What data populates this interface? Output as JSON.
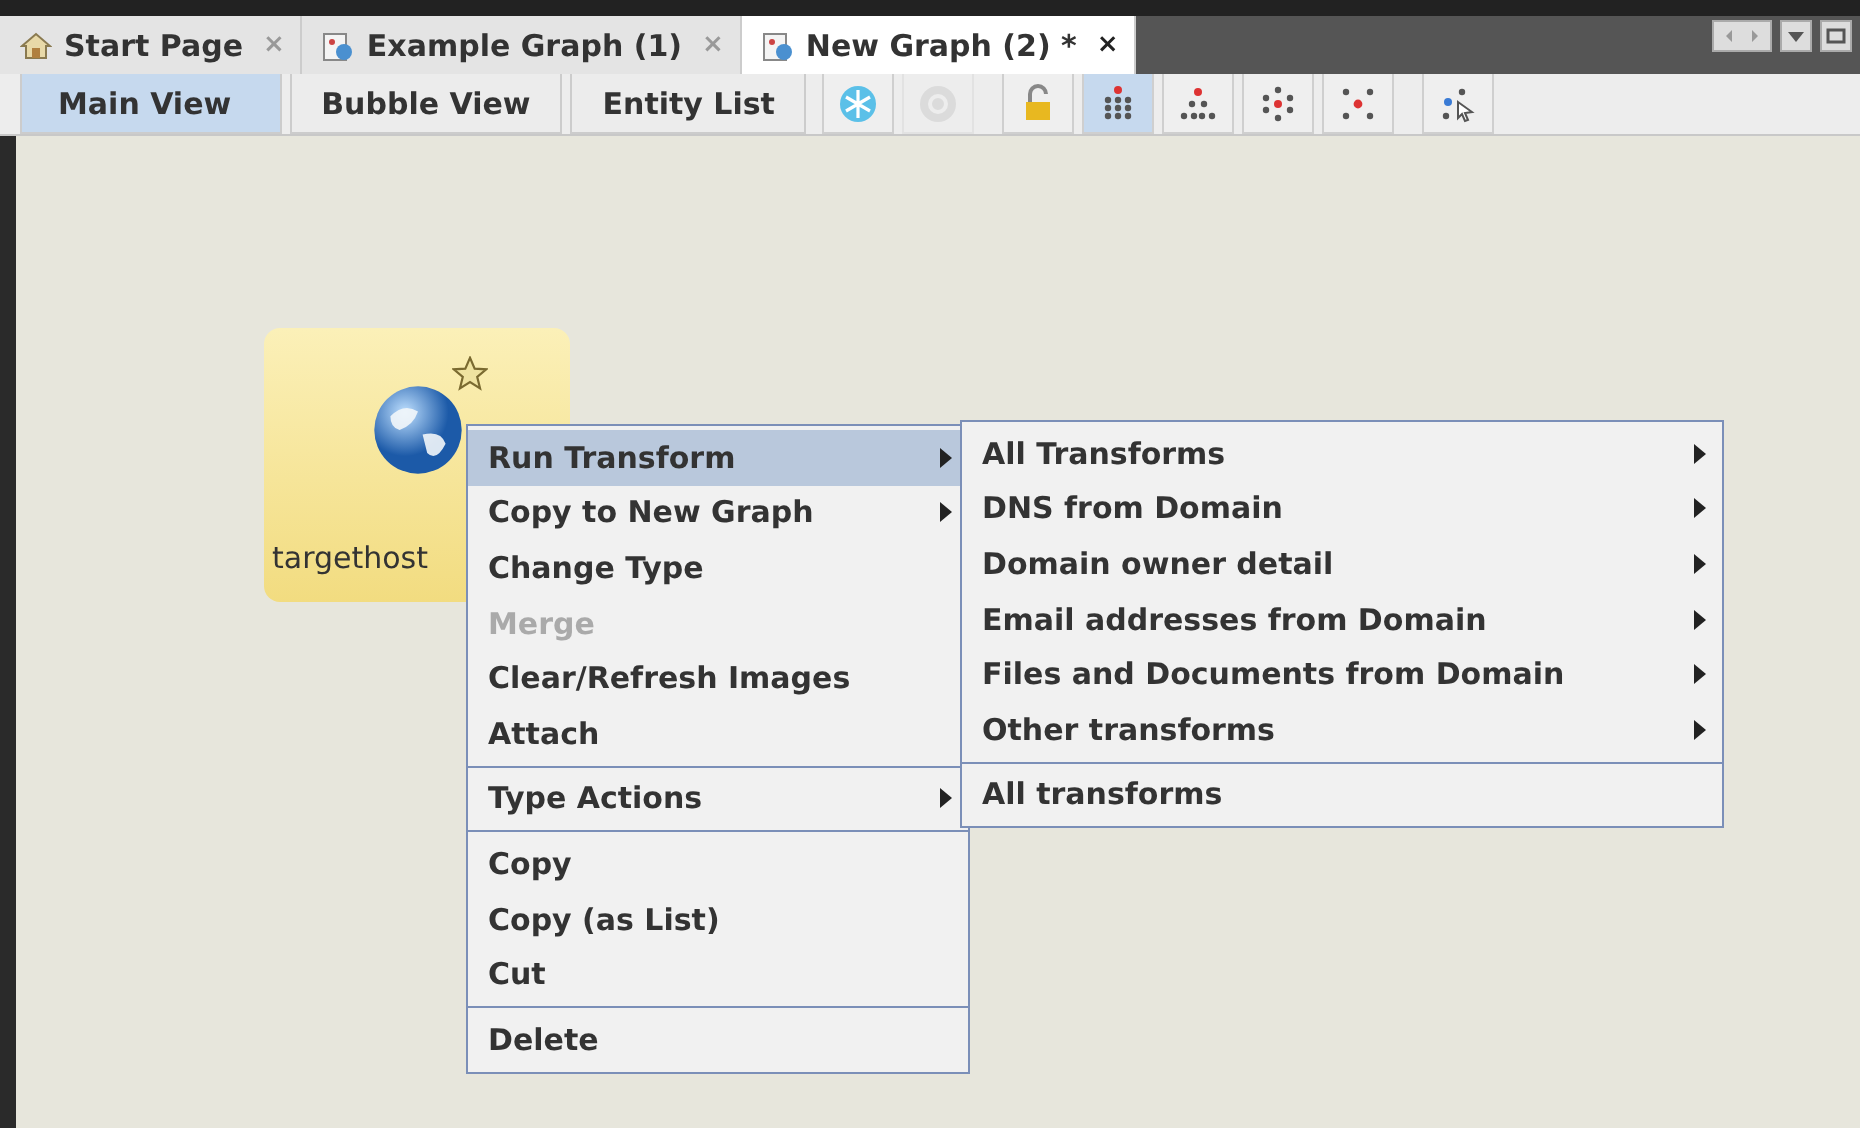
{
  "document_tabs": [
    {
      "label": "Start Page",
      "close": "×",
      "selected": false
    },
    {
      "label": "Example Graph (1)",
      "close": "×",
      "selected": false
    },
    {
      "label": "New Graph (2) *",
      "close": "×",
      "selected": true
    }
  ],
  "view_tabs": [
    {
      "label": "Main View",
      "selected": true
    },
    {
      "label": "Bubble View",
      "selected": false
    },
    {
      "label": "Entity List",
      "selected": false
    }
  ],
  "toolbar_buttons": [
    {
      "kind": "freeze",
      "selected": false,
      "disabled": false
    },
    {
      "kind": "unfreeze",
      "selected": false,
      "disabled": true
    },
    {
      "kind": "lock",
      "selected": false,
      "disabled": false
    },
    {
      "kind": "block",
      "selected": true,
      "disabled": false
    },
    {
      "kind": "hierarchical",
      "selected": false,
      "disabled": false
    },
    {
      "kind": "circular",
      "selected": false,
      "disabled": false
    },
    {
      "kind": "organic",
      "selected": false,
      "disabled": false
    },
    {
      "kind": "select",
      "selected": false,
      "disabled": false
    }
  ],
  "entity": {
    "label": "targethost",
    "bookmarked": true
  },
  "context_menu": {
    "groups": [
      [
        {
          "label": "Run Transform",
          "submenu": true,
          "selected": true,
          "disabled": false
        },
        {
          "label": "Copy to New Graph",
          "submenu": true,
          "selected": false,
          "disabled": false
        },
        {
          "label": "Change Type",
          "submenu": false,
          "selected": false,
          "disabled": false
        },
        {
          "label": "Merge",
          "submenu": false,
          "selected": false,
          "disabled": true
        },
        {
          "label": "Clear/Refresh Images",
          "submenu": false,
          "selected": false,
          "disabled": false
        },
        {
          "label": "Attach",
          "submenu": false,
          "selected": false,
          "disabled": false
        }
      ],
      [
        {
          "label": "Type Actions",
          "submenu": true,
          "selected": false,
          "disabled": false
        }
      ],
      [
        {
          "label": "Copy",
          "submenu": false,
          "selected": false,
          "disabled": false
        },
        {
          "label": "Copy (as List)",
          "submenu": false,
          "selected": false,
          "disabled": false
        },
        {
          "label": "Cut",
          "submenu": false,
          "selected": false,
          "disabled": false
        }
      ],
      [
        {
          "label": "Delete",
          "submenu": false,
          "selected": false,
          "disabled": false
        }
      ]
    ]
  },
  "submenu": {
    "groups": [
      [
        {
          "label": "All Transforms",
          "submenu": true
        },
        {
          "label": "DNS from Domain",
          "submenu": true
        },
        {
          "label": "Domain owner detail",
          "submenu": true
        },
        {
          "label": "Email addresses from Domain",
          "submenu": true
        },
        {
          "label": "Files and Documents from Domain",
          "submenu": true
        },
        {
          "label": "Other transforms",
          "submenu": true
        }
      ],
      [
        {
          "label": "All transforms",
          "submenu": false
        }
      ]
    ]
  }
}
